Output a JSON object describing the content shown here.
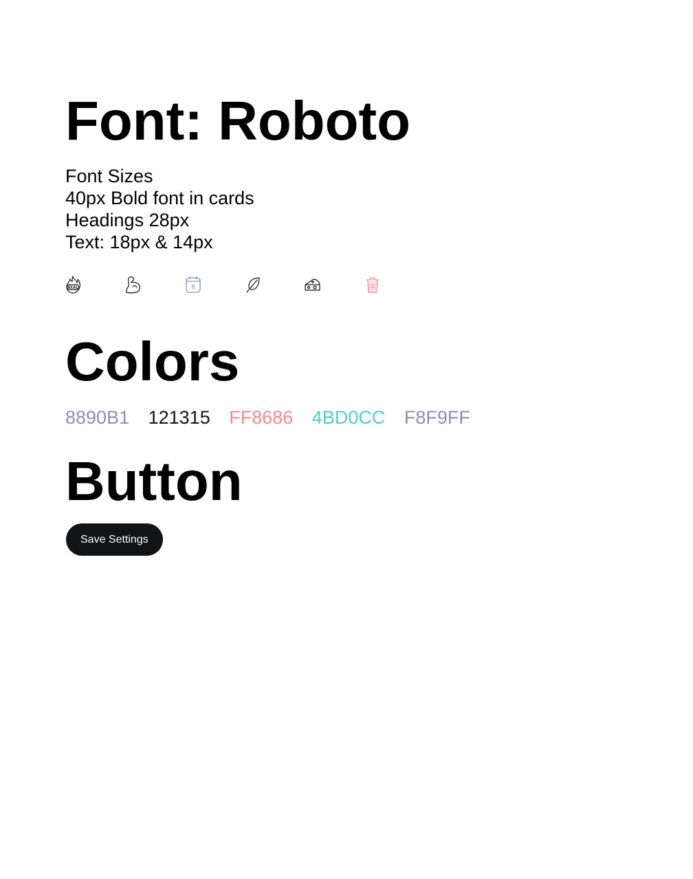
{
  "typography": {
    "title": "Font: Roboto",
    "sizes": [
      "Font Sizes",
      "40px Bold font in cards",
      "Headings 28px",
      "Text: 18px & 14px"
    ]
  },
  "icons": [
    {
      "name": "flame-kcal-icon",
      "label": "KCAL",
      "color": "#121315"
    },
    {
      "name": "muscle-arm-icon",
      "color": "#121315"
    },
    {
      "name": "calendar-icon",
      "label": "8",
      "color": "#8890B1"
    },
    {
      "name": "leaf-icon",
      "color": "#121315"
    },
    {
      "name": "cheese-icon",
      "color": "#121315"
    },
    {
      "name": "trash-icon",
      "color": "#FF8686"
    }
  ],
  "colors": {
    "title": "Colors",
    "swatches": [
      {
        "label": "8890B1",
        "hex": "#8890B1"
      },
      {
        "label": "121315",
        "hex": "#121315"
      },
      {
        "label": "FF8686",
        "hex": "#FF8686"
      },
      {
        "label": "4BD0CC",
        "hex": "#4BD0CC"
      },
      {
        "label": "F8F9FF",
        "hex": "#8890B1"
      }
    ]
  },
  "button": {
    "title": "Button",
    "label": "Save Settings",
    "background": "#121315",
    "text_color": "#FFFFFF"
  }
}
